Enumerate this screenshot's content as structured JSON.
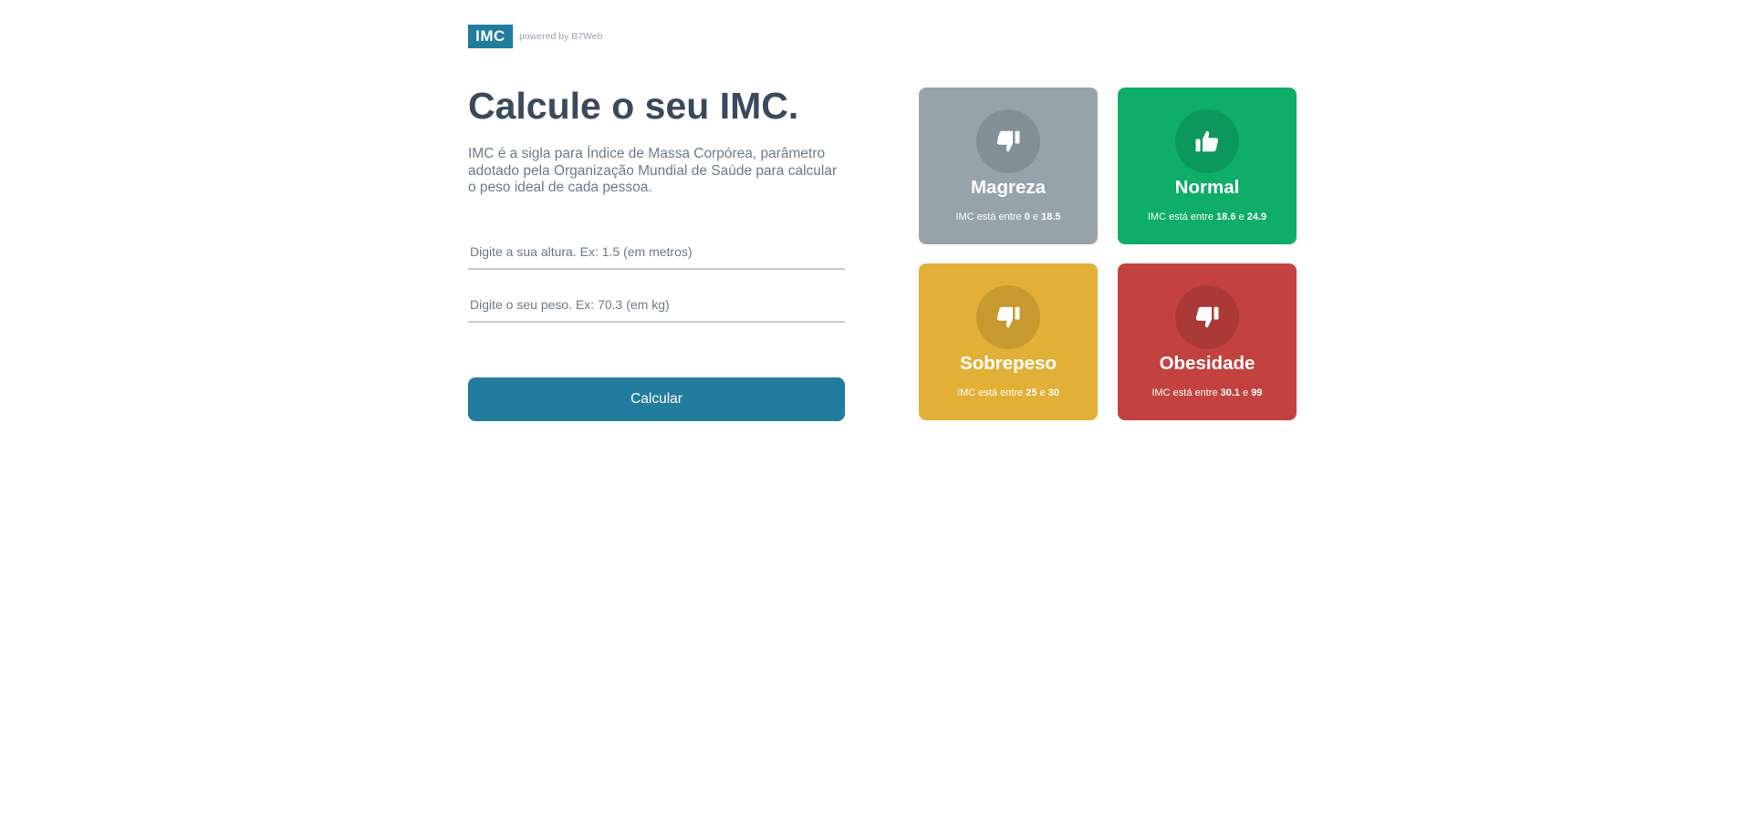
{
  "header": {
    "logo": "IMC",
    "powered_by": "powered by B7Web"
  },
  "main": {
    "title": "Calcule o seu IMC.",
    "description": "IMC é a sigla para Índice de Massa Corpórea, parâmetro adotado pela Organização Mundial de Saúde para calcular o peso ideal de cada pessoa.",
    "height_input": {
      "value": "",
      "placeholder": "Digite a sua altura. Ex: 1.5 (em metros)"
    },
    "weight_input": {
      "value": "",
      "placeholder": "Digite o seu peso. Ex: 70.3 (em kg)"
    },
    "calculate_label": "Calcular"
  },
  "cards": [
    {
      "title": "Magreza",
      "prefix": "IMC está entre",
      "min": "0",
      "and": "e",
      "max": "18.5",
      "color": "#96a3ab",
      "icon": "thumbs-down-icon"
    },
    {
      "title": "Normal",
      "prefix": "IMC está entre",
      "min": "18.6",
      "and": "e",
      "max": "24.9",
      "color": "#0ead69",
      "icon": "thumbs-up-icon"
    },
    {
      "title": "Sobrepeso",
      "prefix": "IMC está entre",
      "min": "25",
      "and": "e",
      "max": "30",
      "color": "#e2b036",
      "icon": "thumbs-down-icon"
    },
    {
      "title": "Obesidade",
      "prefix": "IMC está entre",
      "min": "30.1",
      "and": "e",
      "max": "99",
      "color": "#c3423f",
      "icon": "thumbs-down-icon"
    }
  ]
}
